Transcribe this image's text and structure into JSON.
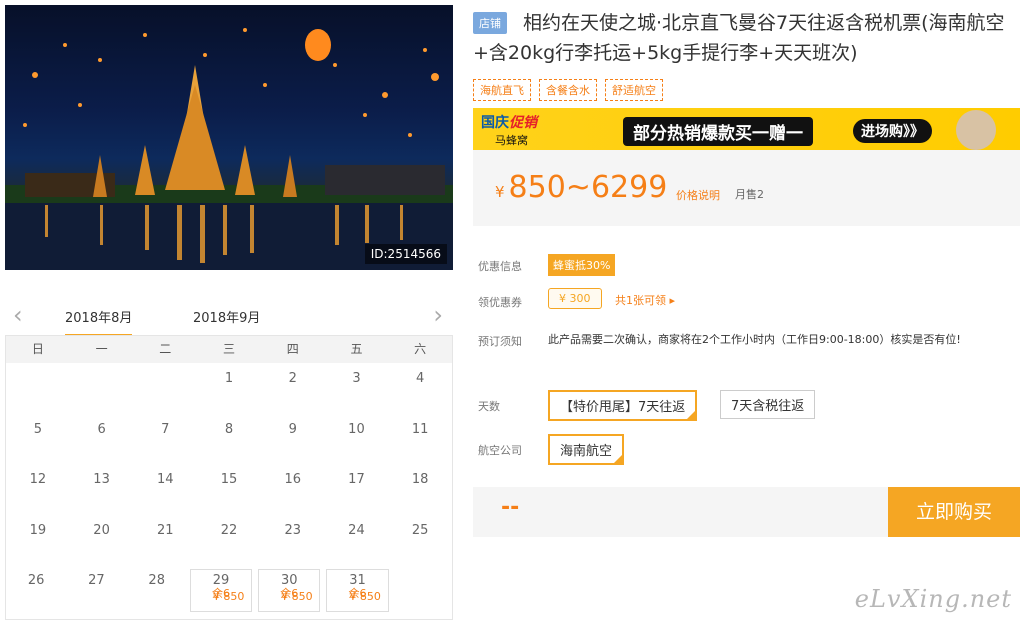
{
  "product": {
    "store_badge": "店铺",
    "title": "相约在天使之城·北京直飞曼谷7天往返含税机票(海南航空+含20kg行李托运+5kg手提行李+天天班次)",
    "tags": [
      "海航直飞",
      "含餐含水",
      "舒适航空"
    ],
    "image_id": "ID:2514566"
  },
  "banner": {
    "brand": "国庆",
    "brand_em": "促销",
    "sub": "马蜂窝",
    "slogan": "部分热销爆款买一赠一",
    "cta": "进场购》》"
  },
  "price": {
    "currency": "¥",
    "range": "850~6299",
    "note": "价格说明",
    "sold": "月售2"
  },
  "info": {
    "promo_label": "优惠信息",
    "promo_value": "蜂蜜抵30%",
    "coupon_label": "领优惠券",
    "coupon_value": "¥ 300",
    "coupon_link": "共1张可领 ▸",
    "notice_label": "预订须知",
    "notice_value": "此产品需要二次确认，商家将在2个工作小时内（工作日9:00-18:00）核实是否有位!"
  },
  "options": {
    "days_label": "天数",
    "days": [
      "【特价甩尾】7天往返",
      "7天含税往返"
    ],
    "airline_label": "航空公司",
    "airlines": [
      "海南航空"
    ]
  },
  "purchase": {
    "qty_placeholder": "--",
    "buy_label": "立即购买"
  },
  "calendar": {
    "tabs": [
      "2018年8月",
      "2018年9月"
    ],
    "weekdays": [
      "日",
      "一",
      "二",
      "三",
      "四",
      "五",
      "六"
    ],
    "weeks": [
      [
        {
          "d": ""
        },
        {
          "d": ""
        },
        {
          "d": ""
        },
        {
          "d": "1"
        },
        {
          "d": "2"
        },
        {
          "d": "3"
        },
        {
          "d": "4"
        }
      ],
      [
        {
          "d": "5"
        },
        {
          "d": "6"
        },
        {
          "d": "7"
        },
        {
          "d": "8"
        },
        {
          "d": "9"
        },
        {
          "d": "10"
        },
        {
          "d": "11"
        }
      ],
      [
        {
          "d": "12"
        },
        {
          "d": "13"
        },
        {
          "d": "14"
        },
        {
          "d": "15"
        },
        {
          "d": "16"
        },
        {
          "d": "17"
        },
        {
          "d": "18"
        }
      ],
      [
        {
          "d": "19"
        },
        {
          "d": "20"
        },
        {
          "d": "21"
        },
        {
          "d": "22"
        },
        {
          "d": "23"
        },
        {
          "d": "24"
        },
        {
          "d": "25"
        }
      ],
      [
        {
          "d": "26"
        },
        {
          "d": "27"
        },
        {
          "d": "28"
        },
        {
          "d": "29",
          "price": "¥ 850",
          "left": "余6"
        },
        {
          "d": "30",
          "price": "¥ 850",
          "left": "余6"
        },
        {
          "d": "31",
          "price": "¥ 850",
          "left": "余6"
        },
        {
          "d": ""
        }
      ]
    ]
  },
  "watermark": "eLvXing.net",
  "colors": {
    "accent": "#f5a623",
    "price": "#f57f17",
    "badge": "#7aa8de"
  }
}
